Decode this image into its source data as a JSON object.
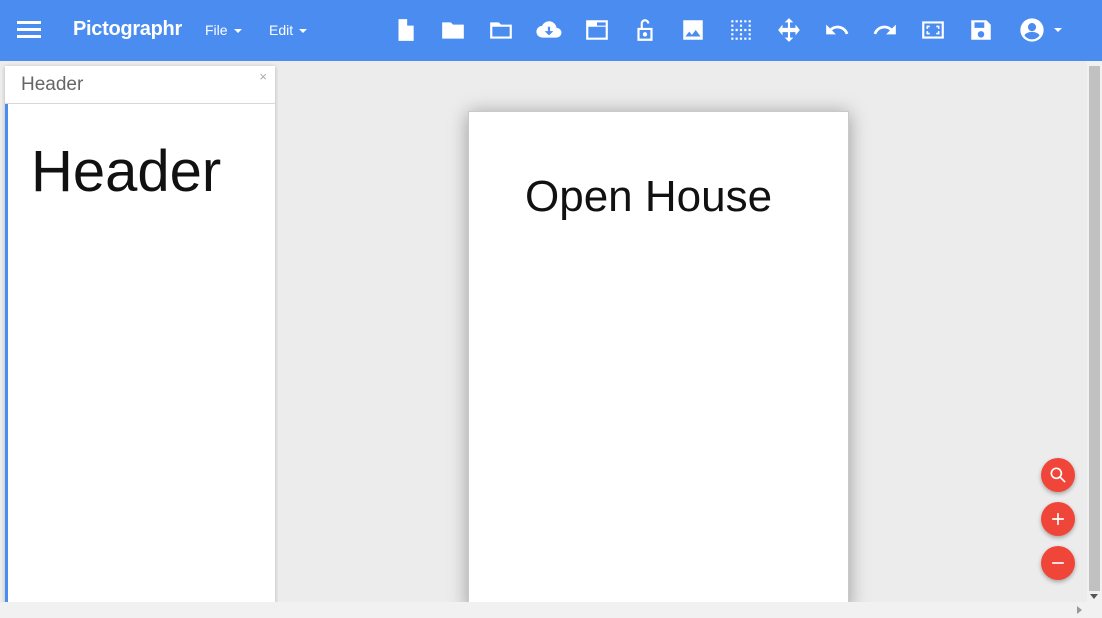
{
  "app": {
    "brand": "Pictographr",
    "accent_color": "#4a8cf0",
    "fab_color": "#f0463a"
  },
  "menus": [
    {
      "label": "File"
    },
    {
      "label": "Edit"
    }
  ],
  "toolbar_icons": [
    "new-document-icon",
    "folder-icon",
    "open-folder-icon",
    "cloud-download-icon",
    "window-icon",
    "unlock-icon",
    "image-icon",
    "grid-icon",
    "move-icon",
    "undo-icon",
    "redo-icon",
    "fit-screen-icon",
    "save-icon",
    "account-icon"
  ],
  "panel": {
    "title": "Header",
    "close": "×",
    "preview_text": "Header"
  },
  "canvas": {
    "text": "Open House"
  },
  "zoom_buttons": [
    "search-icon",
    "plus-icon",
    "minus-icon"
  ]
}
